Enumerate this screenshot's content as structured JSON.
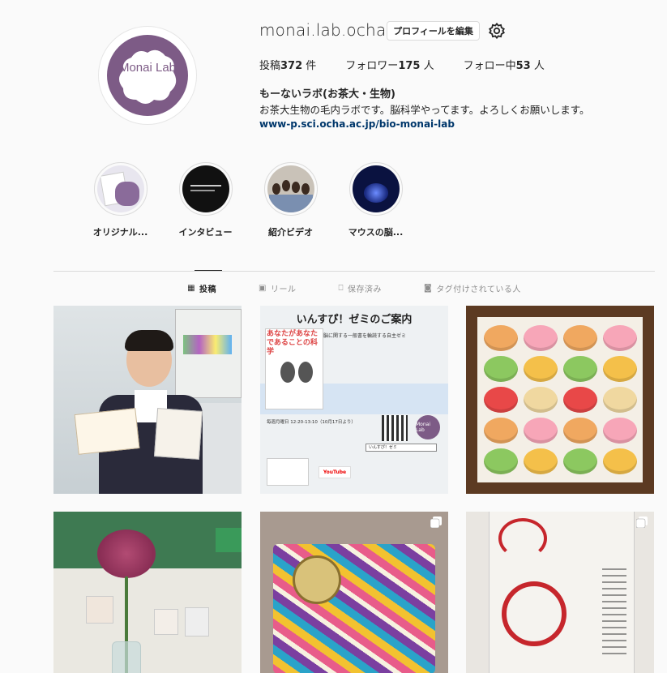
{
  "profile": {
    "username": "monai.lab.ocha",
    "edit_button": "プロフィールを編集",
    "avatar_logo": "Monai Lab",
    "stats": {
      "posts_label": "投稿",
      "posts_count": "372",
      "posts_suffix": " 件",
      "followers_label": "フォロワー",
      "followers_count": "175",
      "followers_suffix": " 人",
      "following_label": "フォロー中",
      "following_count": "53",
      "following_suffix": " 人"
    },
    "full_name": "もーないラボ(お茶大・生物)",
    "bio": "お茶大生物の毛内ラボです。脳科学やってます。よろしくお願いします。",
    "link": "www-p.sci.ocha.ac.jp/bio-monai-lab"
  },
  "highlights": [
    {
      "label": "オリジナル..."
    },
    {
      "label": "インタビュー"
    },
    {
      "label": "紹介ビデオ"
    },
    {
      "label": "マウスの脳..."
    }
  ],
  "tabs": [
    {
      "label": "投稿",
      "icon": "grid-icon",
      "active": true
    },
    {
      "label": "リール",
      "icon": "reels-icon",
      "active": false
    },
    {
      "label": "保存済み",
      "icon": "bookmark-icon",
      "active": false
    },
    {
      "label": "タグ付けされている人",
      "icon": "tag-icon",
      "active": false
    }
  ],
  "posts": {
    "flyer": {
      "title": "いんすぴ！ゼミのご案内",
      "subtitle": "脳に関する一般書を輪読する自主ゼミ",
      "book_title": "あなたがあなたであることの科学",
      "schedule": "毎週月曜日 12:20-13:10（10月17日より）",
      "search_text": "いんすぴ！ゼミ",
      "youtube": "YouTube",
      "logo": "Monai Lab"
    }
  },
  "colors": {
    "brand_purple": "#7d5b86",
    "link": "#00376b",
    "border": "#dbdbdb"
  }
}
